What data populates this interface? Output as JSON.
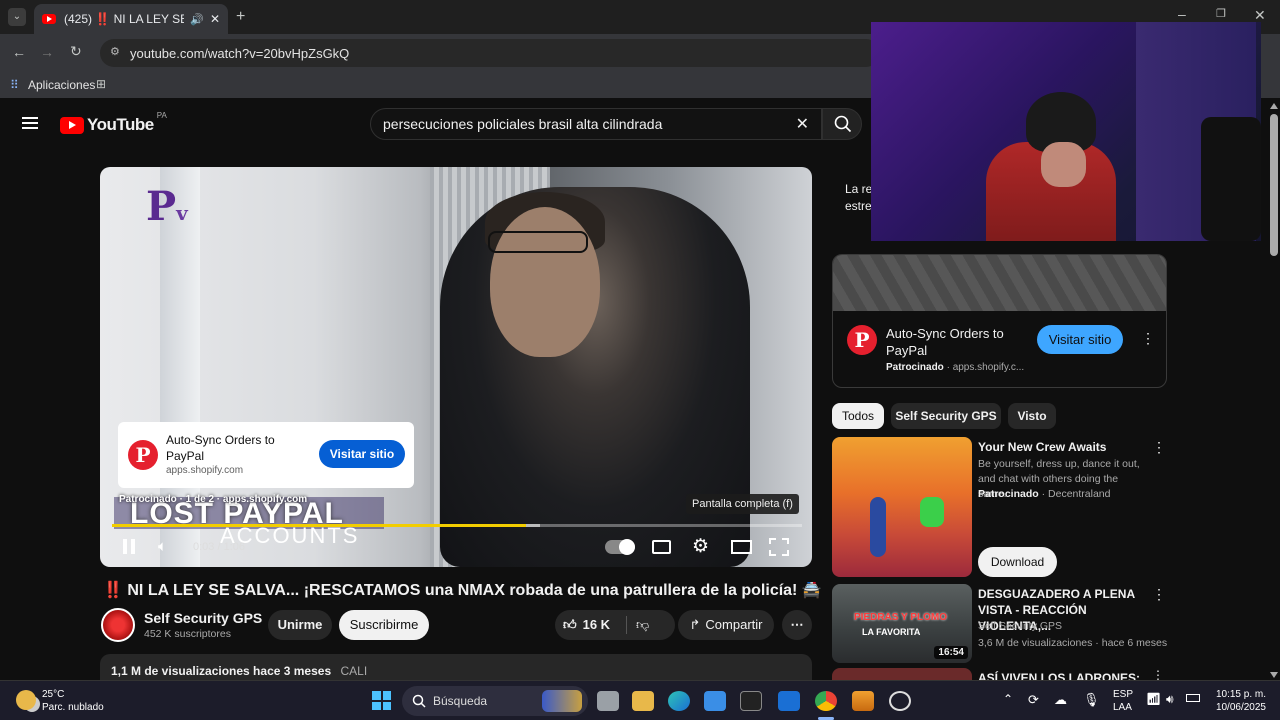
{
  "browser": {
    "tab_title": "(425) ‼️ NI LA LEY SE SALV",
    "url": "youtube.com/watch?v=20bvHpZsGkQ",
    "bookmark_label": "Aplicaciones"
  },
  "youtube": {
    "logo_text": "YouTube",
    "region": "PA",
    "search_query": "persecuciones policiales brasil alta cilindrada"
  },
  "player": {
    "overlay_line1": "LOST PAYPAL",
    "overlay_line2": "ACCOUNTS",
    "ad_card": {
      "title": "Auto-Sync Orders to PayPal",
      "domain": "apps.shopify.com",
      "button": "Visitar sitio",
      "logo_letter": "P"
    },
    "ad_status": "Patrocinado · 1 de 2 · apps.shopify.com",
    "tooltip": "Pantalla completa (f)",
    "time": "0:03 / 1:06",
    "progress": 0.6,
    "buffer": 0.62
  },
  "video": {
    "title": "‼️ NI LA LEY SE SALVA... ¡RESCATAMOS una NMAX robada de una patrullera de la policía! 🚔",
    "channel": "Self Security GPS",
    "subscribers": "452 K suscriptores",
    "join_label": "Unirme",
    "subscribe_label": "Suscribirme",
    "likes": "16 K",
    "share_label": "Compartir",
    "stats": "1,1 M de visualizaciones  hace 3 meses",
    "tag": "CALI"
  },
  "sidebar": {
    "partial_text_1": "La re",
    "partial_text_2": "estre",
    "ad": {
      "title": "Auto-Sync Orders to PayPal",
      "sponsor": "Patrocinado",
      "domain": "apps.shopify.c...",
      "button": "Visitar sitio",
      "logo_letter": "P"
    },
    "chips": [
      "Todos",
      "Self Security GPS",
      "Visto"
    ],
    "recs": [
      {
        "title": "Your New Crew Awaits",
        "desc": "Be yourself, dress up, dance it out, and chat with others doing the same.",
        "sponsor": "Patrocinado",
        "channel": "Decentraland",
        "button": "Download"
      },
      {
        "title": "DESGUAZADERO A PLENA VISTA - REACCIÓN VIOLENTA,...",
        "channel": "Self Security GPS",
        "meta": "3,6 M de visualizaciones · hace 6 meses",
        "duration": "16:54",
        "thumb_text1": "PIEDRAS Y PLOMO",
        "thumb_text2": "LA FAVORITA"
      },
      {
        "title": "ASÍ VIVEN LOS LADRONES:"
      }
    ]
  },
  "taskbar": {
    "temp": "25°C",
    "weather": "Parc. nublado",
    "search": "Búsqueda",
    "lang1": "ESP",
    "lang2": "LAA",
    "time": "10:15 p. m.",
    "date": "10/06/2025"
  }
}
